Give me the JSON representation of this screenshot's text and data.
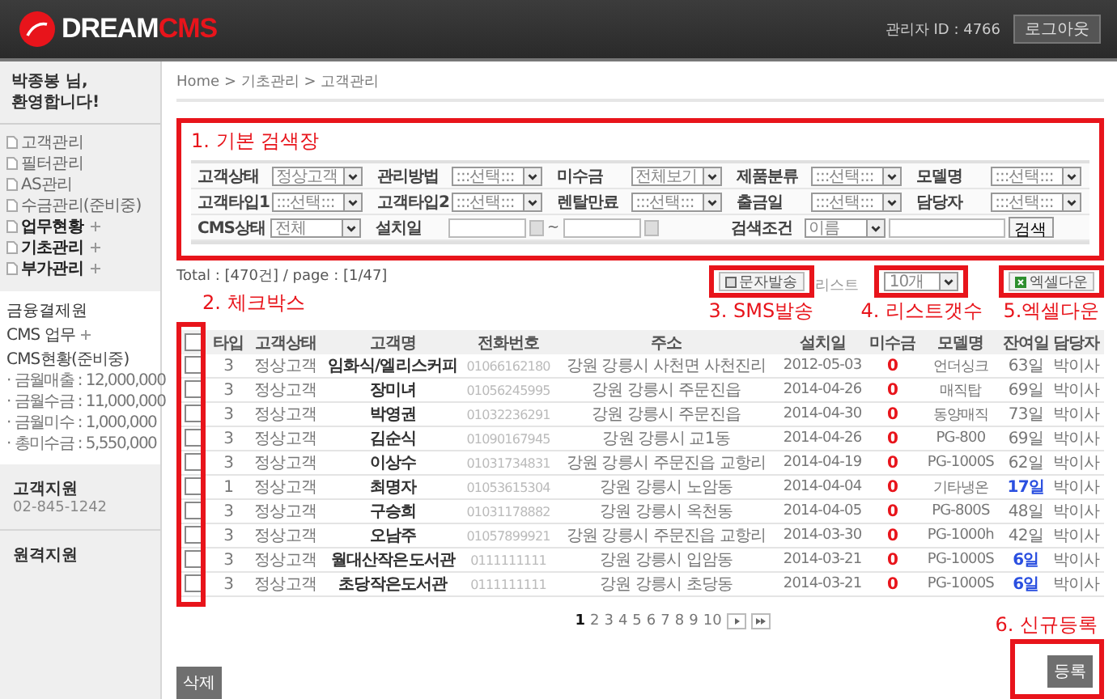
{
  "header": {
    "logo_main": "DREAM",
    "logo_accent": "CMS",
    "admin_id": "관리자 ID : 4766",
    "logout": "로그아웃"
  },
  "sidebar": {
    "greeting_name": "박종봉 님,",
    "greeting_text": "환영합니다!",
    "menu": [
      {
        "label": "고객관리",
        "expandable": false
      },
      {
        "label": "필터관리",
        "expandable": false
      },
      {
        "label": "AS관리",
        "expandable": false
      },
      {
        "label": "수금관리(준비중)",
        "expandable": false
      },
      {
        "label": "업무현황",
        "expandable": true
      },
      {
        "label": "기초관리",
        "expandable": true
      },
      {
        "label": "부가관리",
        "expandable": true
      }
    ],
    "finance_title": "금융결제원",
    "finance_links": [
      {
        "label": "CMS 업무",
        "expandable": true
      },
      {
        "label": "CMS현황(준비중)",
        "expandable": false
      }
    ],
    "stats": [
      "· 금월매출 : 12,000,000",
      "· 금월수금 : 11,000,000",
      "· 금월미수 : 1,000,000",
      "· 총미수금 : 5,550,000"
    ],
    "support_title": "고객지원",
    "support_phone": "02-845-1242",
    "remote_title": "원격지원"
  },
  "breadcrumb": "Home > 기초관리 > 고객관리",
  "annotations": {
    "search": "1. 기본 검색장",
    "checkbox": "2. 체크박스",
    "sms": "3. SMS발송",
    "list": "4. 리스트갯수",
    "excel": "5.엑셀다운",
    "register": "6. 신규등록"
  },
  "search": {
    "rows": [
      [
        {
          "label": "고객상태",
          "kind": "select",
          "value": "정상고객"
        },
        {
          "label": "관리방법",
          "kind": "select",
          "value": ":::선택:::"
        },
        {
          "label": "미수금",
          "kind": "select",
          "value": "전체보기"
        },
        {
          "label": "제품분류",
          "kind": "select",
          "value": ":::선택:::"
        },
        {
          "label": "모델명",
          "kind": "select",
          "value": ":::선택:::"
        }
      ],
      [
        {
          "label": "고객타입1",
          "kind": "select",
          "value": ":::선택:::"
        },
        {
          "label": "고객타입2",
          "kind": "select",
          "value": ":::선택:::"
        },
        {
          "label": "렌탈만료",
          "kind": "select",
          "value": ":::선택:::"
        },
        {
          "label": "출금일",
          "kind": "select",
          "value": ":::선택:::"
        },
        {
          "label": "담당자",
          "kind": "select",
          "value": ":::선택:::"
        }
      ],
      [
        {
          "label": "CMS상태",
          "kind": "select",
          "value": "전체"
        },
        {
          "label": "설치일",
          "kind": "date_range",
          "separator": "~"
        },
        "",
        {
          "label": "검색조건",
          "kind": "search",
          "value": "이름",
          "button": "검색"
        }
      ]
    ]
  },
  "total": "Total : [470건] / page : [1/47]",
  "toolbar": {
    "sms_button": "문자발송",
    "list_label": "리스트",
    "list_size": "10개",
    "excel_button": "엑셀다운"
  },
  "table": {
    "header_checked": false,
    "columns": [
      "타입",
      "고객상태",
      "고객명",
      "전화번호",
      "주소",
      "설치일",
      "미수금",
      "모델명",
      "잔여일",
      "담당자"
    ],
    "rows": [
      {
        "checked": false,
        "type": "3",
        "status": "정상고객",
        "name": "임화식/엘리스커피",
        "phone": "01066162180",
        "address": "강원 강릉시 사천면 사천진리",
        "installed": "2012-05-03",
        "unpaid": "0",
        "model": "언더싱크",
        "remaining": "63일",
        "urgent": false,
        "manager": "박이사"
      },
      {
        "checked": false,
        "type": "3",
        "status": "정상고객",
        "name": "장미녀",
        "phone": "01056245995",
        "address": "강원 강릉시 주문진읍",
        "installed": "2014-04-26",
        "unpaid": "0",
        "model": "매직탑",
        "remaining": "69일",
        "urgent": false,
        "manager": "박이사"
      },
      {
        "checked": false,
        "type": "3",
        "status": "정상고객",
        "name": "박영권",
        "phone": "01032236291",
        "address": "강원 강릉시 주문진읍",
        "installed": "2014-04-30",
        "unpaid": "0",
        "model": "동양매직",
        "remaining": "73일",
        "urgent": false,
        "manager": "박이사"
      },
      {
        "checked": false,
        "type": "3",
        "status": "정상고객",
        "name": "김순식",
        "phone": "01090167945",
        "address": "강원 강릉시 교1동",
        "installed": "2014-04-26",
        "unpaid": "0",
        "model": "PG-800",
        "remaining": "69일",
        "urgent": false,
        "manager": "박이사"
      },
      {
        "checked": false,
        "type": "3",
        "status": "정상고객",
        "name": "이상수",
        "phone": "01031734831",
        "address": "강원 강릉시 주문진읍 교항리",
        "installed": "2014-04-19",
        "unpaid": "0",
        "model": "PG-1000S",
        "remaining": "62일",
        "urgent": false,
        "manager": "박이사"
      },
      {
        "checked": false,
        "type": "1",
        "status": "정상고객",
        "name": "최명자",
        "phone": "01053615304",
        "address": "강원 강릉시 노암동",
        "installed": "2014-04-04",
        "unpaid": "0",
        "model": "기타냉온",
        "remaining": "17일",
        "urgent": true,
        "manager": "박이사"
      },
      {
        "checked": false,
        "type": "3",
        "status": "정상고객",
        "name": "구승희",
        "phone": "01031178882",
        "address": "강원 강릉시 옥천동",
        "installed": "2014-04-05",
        "unpaid": "0",
        "model": "PG-800S",
        "remaining": "48일",
        "urgent": false,
        "manager": "박이사"
      },
      {
        "checked": false,
        "type": "3",
        "status": "정상고객",
        "name": "오남주",
        "phone": "01057899921",
        "address": "강원 강릉시 주문진읍 교항리",
        "installed": "2014-03-30",
        "unpaid": "0",
        "model": "PG-1000h",
        "remaining": "42일",
        "urgent": false,
        "manager": "박이사"
      },
      {
        "checked": false,
        "type": "3",
        "status": "정상고객",
        "name": "월대산작은도서관",
        "phone": "0111111111",
        "address": "강원 강릉시 입암동",
        "installed": "2014-03-21",
        "unpaid": "0",
        "model": "PG-1000S",
        "remaining": "6일",
        "urgent": true,
        "manager": "박이사"
      },
      {
        "checked": false,
        "type": "3",
        "status": "정상고객",
        "name": "초당작은도서관",
        "phone": "0111111111",
        "address": "강원 강릉시 초당동",
        "installed": "2014-03-21",
        "unpaid": "0",
        "model": "PG-1000S",
        "remaining": "6일",
        "urgent": true,
        "manager": "박이사"
      }
    ]
  },
  "pagination": [
    {
      "label": "1",
      "selected": true
    },
    {
      "label": "2",
      "selected": false
    },
    {
      "label": "3",
      "selected": false
    },
    {
      "label": "4",
      "selected": false
    },
    {
      "label": "5",
      "selected": false
    },
    {
      "label": "6",
      "selected": false
    },
    {
      "label": "7",
      "selected": false
    },
    {
      "label": "8",
      "selected": false
    },
    {
      "label": "9",
      "selected": false
    },
    {
      "label": "10",
      "selected": false
    }
  ],
  "delete_button": "삭제",
  "register_button": "등록"
}
